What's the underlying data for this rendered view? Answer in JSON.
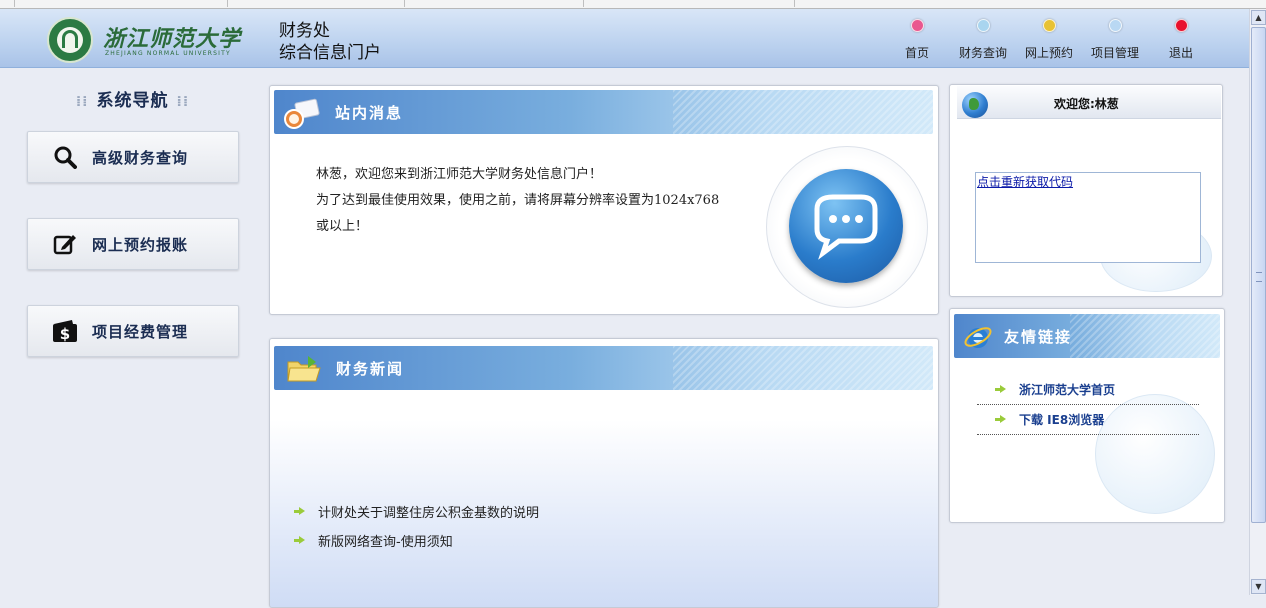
{
  "header": {
    "logo_cn": "浙江师范大学",
    "logo_en": "ZHEJIANG NORMAL UNIVERSITY",
    "title_line1": "财务处",
    "title_line2": "综合信息门户"
  },
  "top_nav": [
    {
      "label": "首页",
      "color": "#e9578f"
    },
    {
      "label": "财务查询",
      "color": "#a9d5ef"
    },
    {
      "label": "网上预约",
      "color": "#e8c233"
    },
    {
      "label": "项目管理",
      "color": "#b9d8f3"
    },
    {
      "label": "退出",
      "color": "#e8112d"
    }
  ],
  "sidebar": {
    "title": "系统导航",
    "items": [
      {
        "label": "高级财务查询",
        "icon": "search-icon"
      },
      {
        "label": "网上预约报账",
        "icon": "edit-icon"
      },
      {
        "label": "项目经费管理",
        "icon": "wallet-icon"
      }
    ]
  },
  "messages": {
    "title": "站内消息",
    "line1": "林葱，欢迎您来到浙江师范大学财务处信息门户！",
    "line2": "为了达到最佳使用效果，使用之前，请将屏幕分辨率设置为1024x768",
    "line3": "或以上！"
  },
  "news": {
    "title": "财务新闻",
    "items": [
      {
        "label": "计财处关于调整住房公积金基数的说明"
      },
      {
        "label": "新版网络查询-使用须知"
      }
    ]
  },
  "welcome": {
    "text": "欢迎您:林葱",
    "code_link": "点击重新获取代码"
  },
  "links": {
    "title": "友情链接",
    "items": [
      {
        "label": "浙江师范大学首页"
      },
      {
        "label": "下载  IE8浏览器"
      }
    ]
  }
}
